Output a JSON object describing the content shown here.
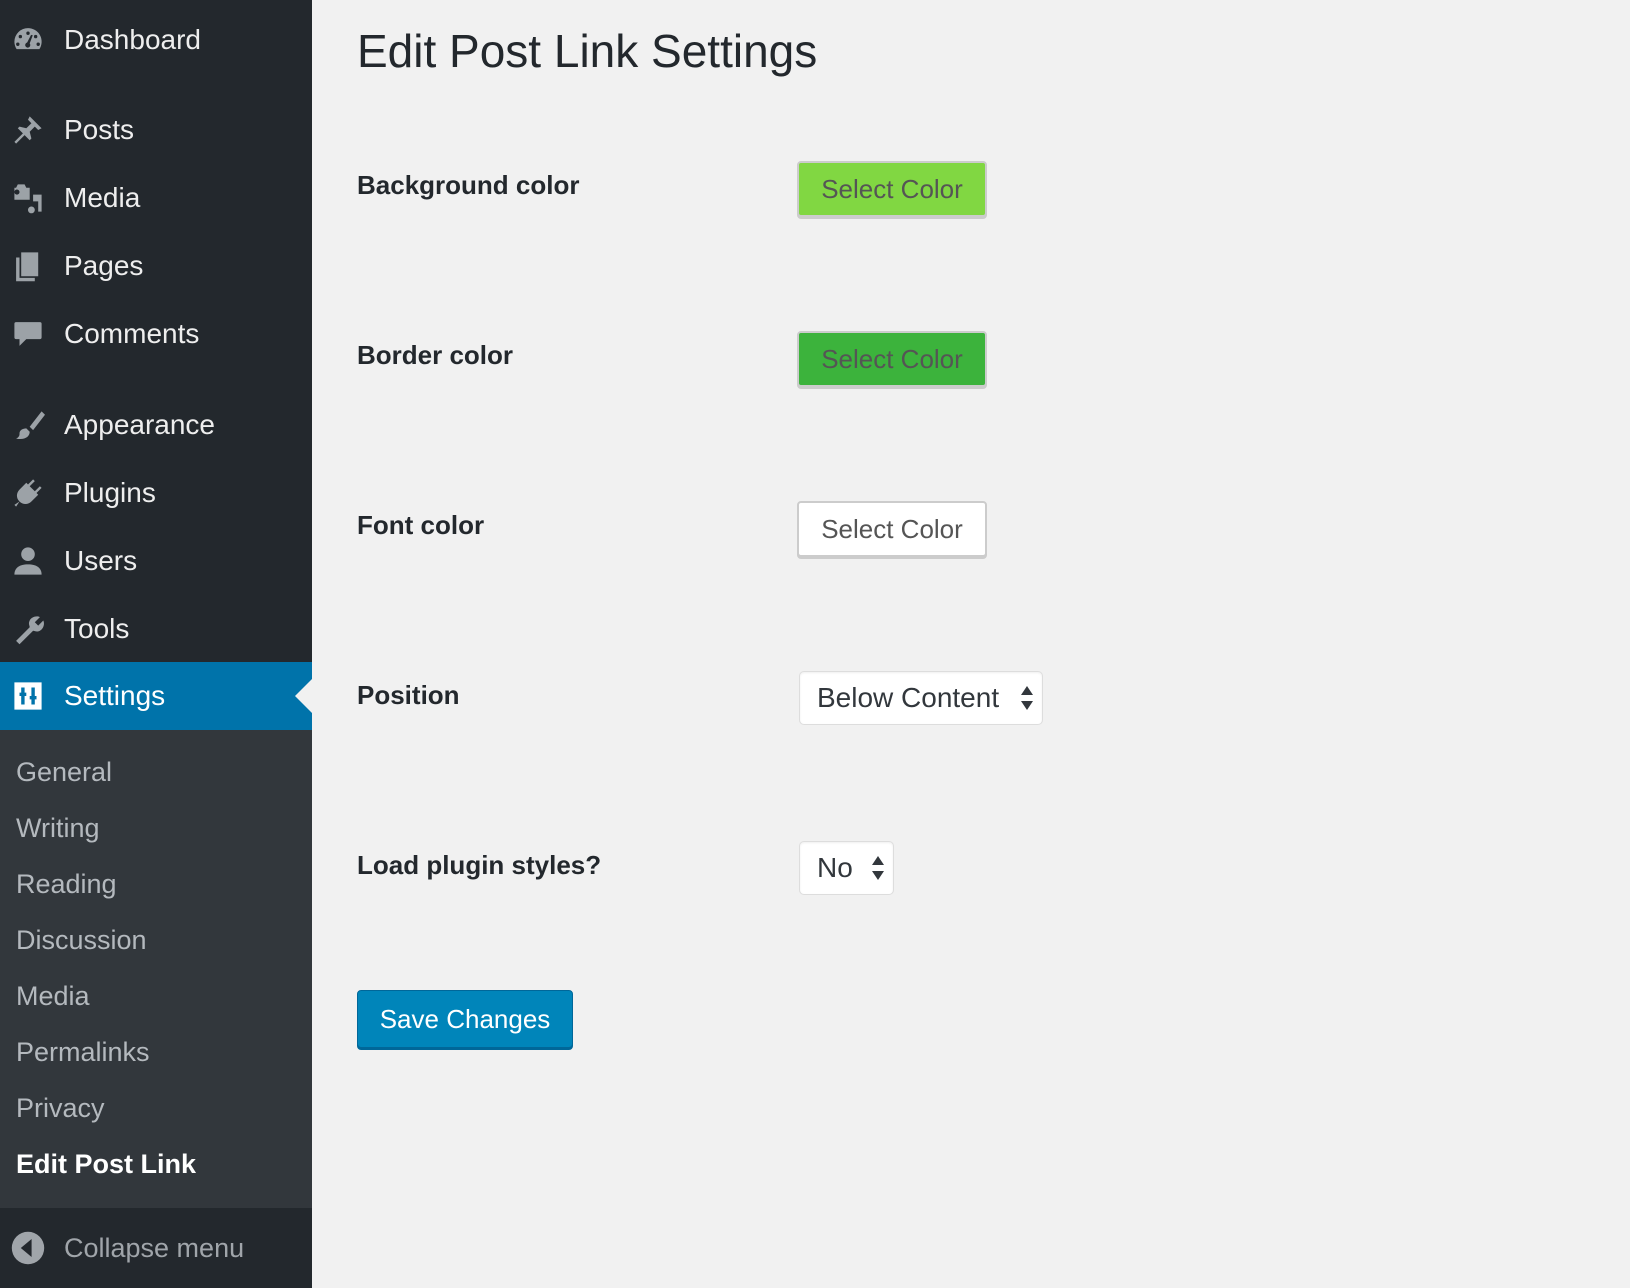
{
  "sidebar": {
    "menu": [
      {
        "label": "Dashboard",
        "icon": "dashboard-icon"
      },
      {
        "label": "Posts",
        "icon": "pushpin-icon"
      },
      {
        "label": "Media",
        "icon": "media-icon"
      },
      {
        "label": "Pages",
        "icon": "pages-icon"
      },
      {
        "label": "Comments",
        "icon": "comment-icon"
      },
      {
        "label": "Appearance",
        "icon": "paintbrush-icon"
      },
      {
        "label": "Plugins",
        "icon": "plugin-icon"
      },
      {
        "label": "Users",
        "icon": "user-icon"
      },
      {
        "label": "Tools",
        "icon": "wrench-icon"
      },
      {
        "label": "Settings",
        "icon": "settings-sliders-icon"
      }
    ],
    "submenu": [
      "General",
      "Writing",
      "Reading",
      "Discussion",
      "Media",
      "Permalinks",
      "Privacy",
      "Edit Post Link"
    ],
    "collapse_label": "Collapse menu"
  },
  "main": {
    "title": "Edit Post Link Settings",
    "fields": {
      "background_color": {
        "label": "Background color",
        "button": "Select Color",
        "swatch": "#81d742"
      },
      "border_color": {
        "label": "Border color",
        "button": "Select Color",
        "swatch": "#3cb33c"
      },
      "font_color": {
        "label": "Font color",
        "button": "Select Color",
        "swatch": "#ffffff"
      },
      "position": {
        "label": "Position",
        "value": "Below Content"
      },
      "load_styles": {
        "label": "Load plugin styles?",
        "value": "No"
      }
    },
    "save_label": "Save Changes"
  },
  "colors": {
    "sidebar_bg": "#23282d",
    "submenu_bg": "#32373c",
    "active_bg": "#0073aa",
    "primary_button": "#0085ba"
  }
}
